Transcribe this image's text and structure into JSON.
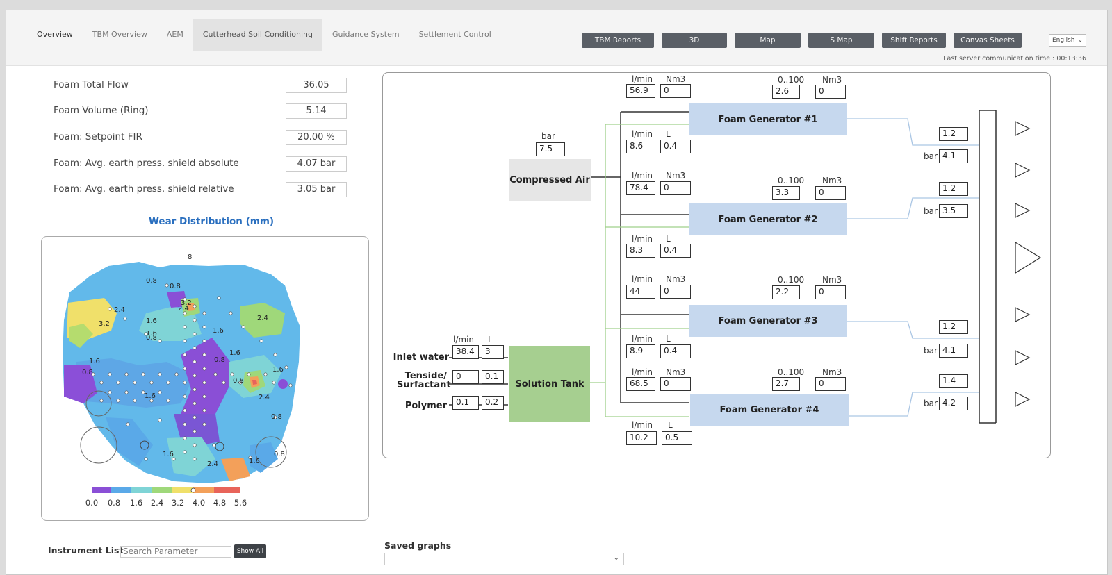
{
  "nav": {
    "tabs": [
      "Overview",
      "TBM Overview",
      "AEM",
      "Cutterhead Soil Conditioning",
      "Guidance System",
      "Settlement Control"
    ],
    "buttons": [
      "TBM Reports",
      "3D",
      "Map",
      "S Map",
      "Shift Reports",
      "Canvas Sheets"
    ],
    "language": "English",
    "last_comm": "Last server communication time : 00:13:36"
  },
  "fields": [
    {
      "label": "Foam Total Flow",
      "value": "36.05"
    },
    {
      "label": "Foam Volume (Ring)",
      "value": "5.14"
    },
    {
      "label": "Foam: Setpoint FIR",
      "value": "20.00 %"
    },
    {
      "label": "Foam: Avg. earth press. shield absolute",
      "value": "4.07 bar"
    },
    {
      "label": "Foam: Avg. earth press. shield relative",
      "value": "3.05 bar"
    }
  ],
  "wear": {
    "title": "Wear Distribution (mm)",
    "colorbar_ticks": [
      "0.0",
      "0.8",
      "1.6",
      "2.4",
      "3.2",
      "4.0",
      "4.8",
      "5.6"
    ],
    "colorbar_colors": [
      "#8a4fd6",
      "#5aa9e8",
      "#7fd4d6",
      "#9fd87a",
      "#f0e06a",
      "#f3a05a",
      "#e8645a"
    ],
    "point_labels": [
      "8",
      "0.8",
      "0.8",
      "2.4",
      "2.4",
      "3.2",
      "1.6",
      "1.6",
      "0.8",
      "3.2",
      "2.4",
      "1.6",
      "0.8",
      "0.8",
      "1.6",
      "1.6",
      "1.6",
      "0.8",
      "2.4",
      "1.6",
      "0.8",
      "1.6",
      "2.4",
      "1.6",
      "0.8"
    ]
  },
  "instrument": {
    "title": "Instrument List",
    "search_placeholder": "Search Parameter",
    "show_all": "Show All"
  },
  "saved_graphs": {
    "title": "Saved graphs"
  },
  "diagram": {
    "compressed_air": {
      "label": "Compressed Air",
      "unit": "bar",
      "value": "7.5"
    },
    "solution_tank": {
      "label": "Solution Tank"
    },
    "inlets": [
      {
        "label": "Inlet water",
        "units": [
          "l/min",
          "L"
        ],
        "values": [
          "38.4",
          "3"
        ]
      },
      {
        "label": "Tenside/ Surfactant",
        "values": [
          "0",
          "0.1"
        ]
      },
      {
        "label": "Polymer",
        "values": [
          "0.1",
          "0.2"
        ]
      }
    ],
    "generators": [
      {
        "label": "Foam Generator #1",
        "air": {
          "units": [
            "l/min",
            "Nm3"
          ],
          "values": [
            "56.9",
            "0"
          ]
        },
        "setp": {
          "units": [
            "0..100",
            "Nm3"
          ],
          "values": [
            "2.6",
            "0"
          ]
        },
        "liquid": {
          "units": [
            "l/min",
            "L"
          ],
          "values": [
            "8.6",
            "0.4"
          ]
        },
        "out": {
          "top": "1.2",
          "unit": "bar",
          "bottom": "4.1"
        }
      },
      {
        "label": "Foam Generator #2",
        "air": {
          "units": [
            "l/min",
            "Nm3"
          ],
          "values": [
            "78.4",
            "0"
          ]
        },
        "setp": {
          "units": [
            "0..100",
            "Nm3"
          ],
          "values": [
            "3.3",
            "0"
          ]
        },
        "liquid": {
          "units": [
            "l/min",
            "L"
          ],
          "values": [
            "8.3",
            "0.4"
          ]
        },
        "out": {
          "top": "1.2",
          "unit": "bar",
          "bottom": "3.5"
        }
      },
      {
        "label": "Foam Generator #3",
        "air": {
          "units": [
            "l/min",
            "Nm3"
          ],
          "values": [
            "44",
            "0"
          ]
        },
        "setp": {
          "units": [
            "0..100",
            "Nm3"
          ],
          "values": [
            "2.2",
            "0"
          ]
        },
        "liquid": {
          "units": [
            "l/min",
            "L"
          ],
          "values": [
            "8.9",
            "0.4"
          ]
        },
        "out": {
          "top": "1.2",
          "unit": "bar",
          "bottom": "4.1"
        }
      },
      {
        "label": "Foam Generator #4",
        "air": {
          "units": [
            "l/min",
            "Nm3"
          ],
          "values": [
            "68.5",
            "0"
          ]
        },
        "setp": {
          "units": [
            "0..100",
            "Nm3"
          ],
          "values": [
            "2.7",
            "0"
          ]
        },
        "liquid": {
          "units": [
            "l/min",
            "L"
          ],
          "values": [
            "10.2",
            "0.5"
          ]
        },
        "out": {
          "top": "1.4",
          "unit": "bar",
          "bottom": "4.2"
        }
      }
    ]
  }
}
